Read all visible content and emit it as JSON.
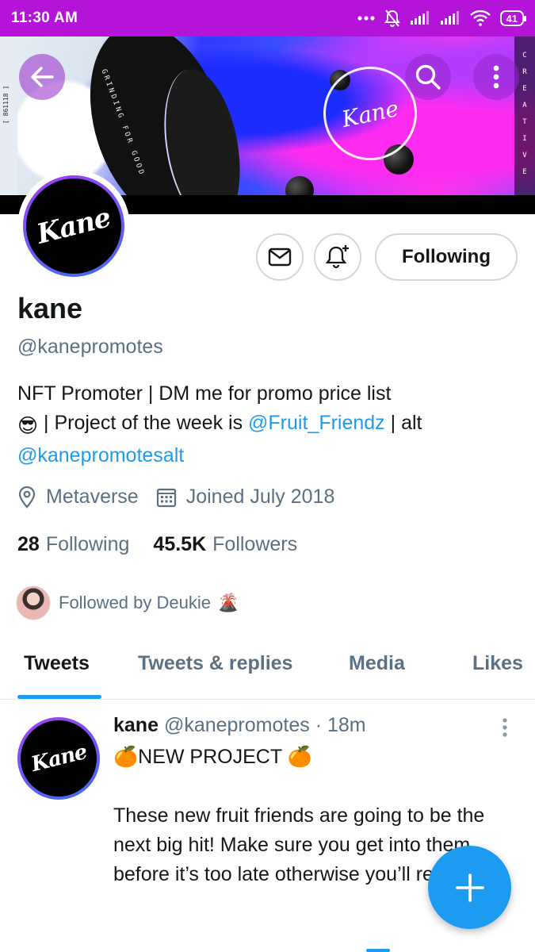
{
  "status_bar": {
    "time": "11:30 AM",
    "battery": "41"
  },
  "banner": {
    "ring_signature": "Kane",
    "curve_text": "GRINDING FOR GOOD",
    "curve_text_2": "EDITOR / PLAYER",
    "side_right_text": "CREATIVE",
    "side_left_text": "[ 861118 ]"
  },
  "profile": {
    "avatar_signature": "Kane",
    "following_button": "Following",
    "name": "kane",
    "handle": "@kanepromotes",
    "bio": {
      "line1": "NFT Promoter | DM me for promo price list",
      "emoji": "😎",
      "line2_a": "| Project of the week is",
      "mention1": "@Fruit_Friendz",
      "line2_b": "| alt",
      "mention2": "@kanepromotesalt"
    },
    "location": "Metaverse",
    "joined": "Joined July 2018",
    "following_count": "28",
    "following_label": "Following",
    "followers_count": "45.5K",
    "followers_label": "Followers",
    "followed_by": "Followed by Deukie",
    "followed_by_emoji": "🌋"
  },
  "tabs": [
    "Tweets",
    "Tweets & replies",
    "Media",
    "Likes"
  ],
  "tweet": {
    "name": "kane",
    "handle": "@kanepromotes",
    "time": "· 18m",
    "avatar_signature": "Kane",
    "title_emoji": "🍊",
    "title": "NEW PROJECT",
    "body": "These new fruit friends are going to be the next big hit! Make sure you get into them before it’s too late otherwise you’ll regret it!"
  },
  "colors": {
    "accent": "#1d9bf0",
    "status_bar": "#b414d8",
    "secondary_text": "#5b7083"
  }
}
